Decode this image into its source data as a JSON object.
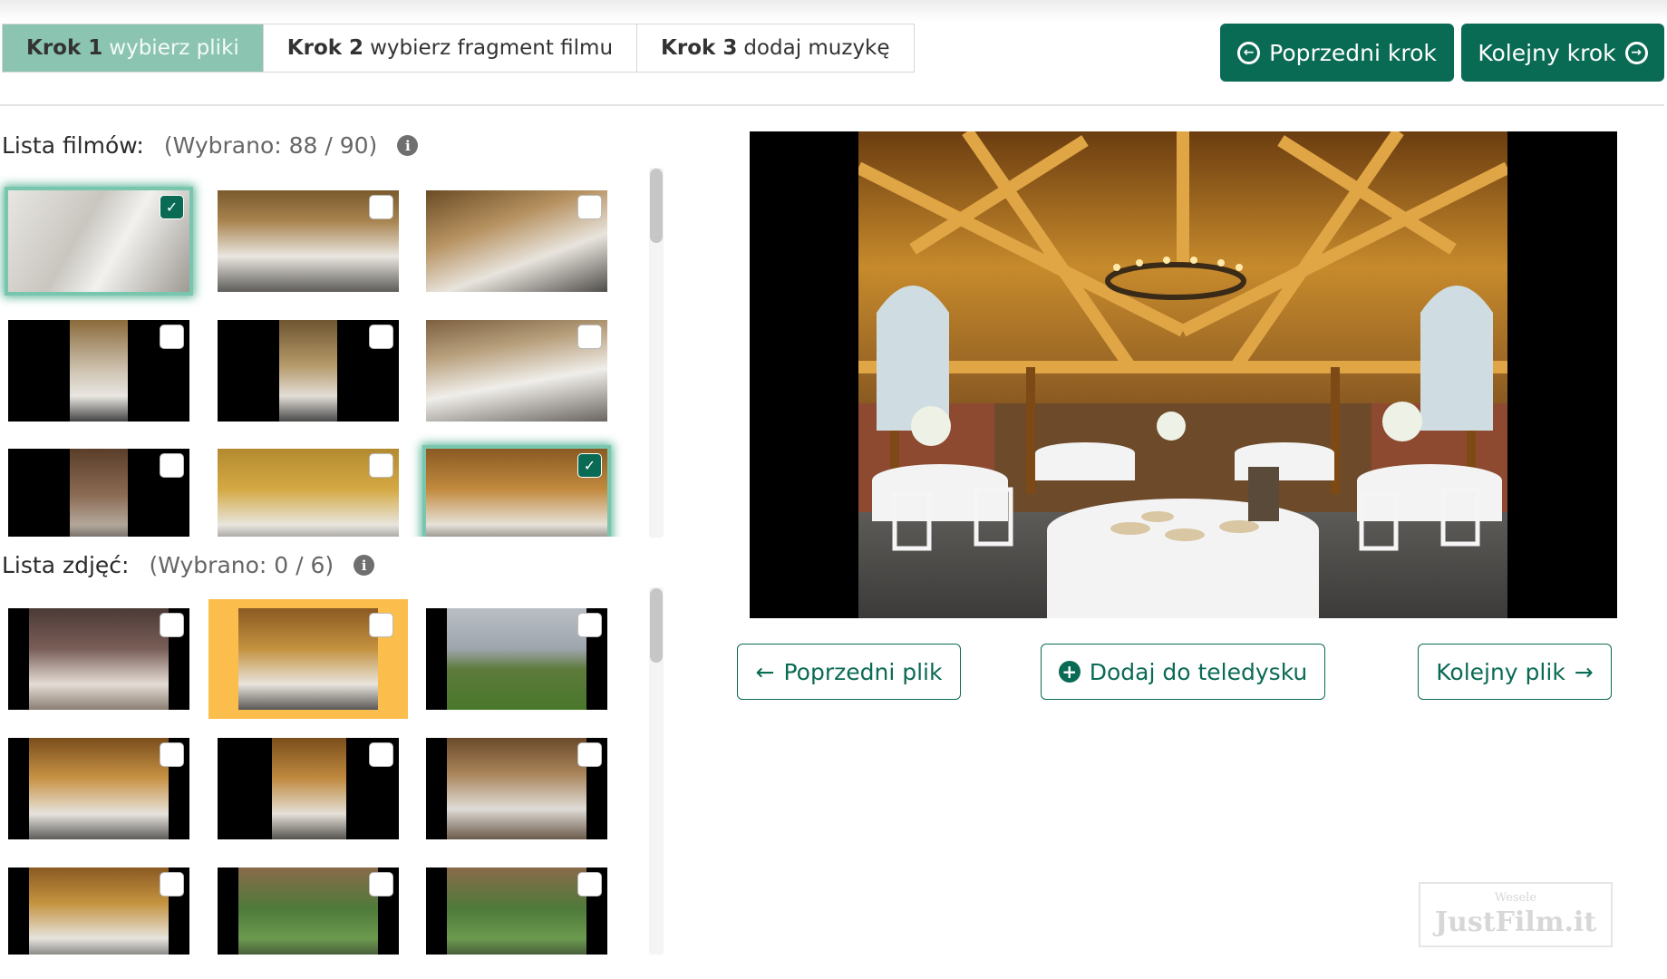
{
  "steps": [
    {
      "bold": "Krok 1",
      "rest": "wybierz pliki",
      "active": true
    },
    {
      "bold": "Krok 2",
      "rest": "wybierz fragment filmu",
      "active": false
    },
    {
      "bold": "Krok 3",
      "rest": "dodaj muzykę",
      "active": false
    }
  ],
  "nav": {
    "prev_step_label": "Poprzedni krok",
    "next_step_label": "Kolejny krok"
  },
  "films": {
    "title": "Lista filmów:",
    "count": "(Wybrano: 88 / 90)",
    "info_glyph": "i"
  },
  "photos": {
    "title": "Lista zdjęć:",
    "count": "(Wybrano: 0 / 6)",
    "info_glyph": "i"
  },
  "preview": {
    "prev_file_label": "Poprzedni plik",
    "add_label": "Dodaj do teledysku",
    "next_file_label": "Kolejny plik"
  },
  "watermark": {
    "small": "Wesele",
    "big": "JustFilm.it"
  },
  "icons": {
    "prev_step": "arrow-circle-left-icon",
    "next_step": "arrow-circle-right-icon",
    "info": "info-icon",
    "check": "check-icon",
    "prev_file": "arrow-left-icon",
    "add": "plus-circle-icon",
    "next_file": "arrow-right-icon"
  },
  "colors": {
    "primary": "#0a6b55",
    "active_step": "#8bc4b1",
    "highlight": "#fbbd4b"
  }
}
